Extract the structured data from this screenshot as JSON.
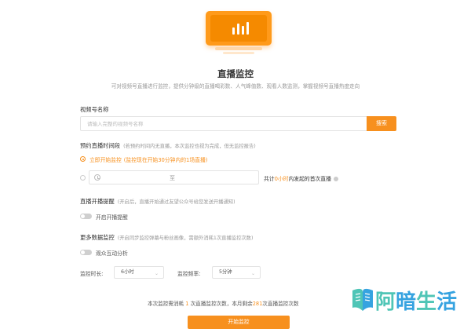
{
  "header": {
    "title": "直播监控",
    "subtitle": "可对视频号直播进行监控，提供分钟级的直播喝彩数、人气峰值数、观看人数监测，掌握视频号直播热度走向"
  },
  "channel": {
    "label": "视频号名称",
    "placeholder": "请输入完整的视频号名称",
    "value": "",
    "search_label": "搜索"
  },
  "schedule": {
    "label": "预约直播时间段",
    "note": "(若预约时间内无直播，本次监控也视为完成，但无监控报告)",
    "option_now": "立即开始监控",
    "option_now_note": "(监控现在开始30分钟内的1场直播)",
    "option_now_selected": true,
    "range_separator": "至",
    "range_summary_prefix": "共计",
    "range_summary_hours": "0小时",
    "range_summary_suffix": "内发起的首次直播"
  },
  "remind": {
    "label": "直播开播提醒",
    "note": "(开启后，直播开始通过友望公众号给您发送开播通知)",
    "toggle_label": "开启开播提醒",
    "enabled": false
  },
  "more": {
    "label": "更多数据监控",
    "note": "(开启同步监控弹幕与粉丝画像，需额外消耗1次直播监控次数)",
    "toggle_label": "观众互动分析",
    "enabled": false
  },
  "settings": {
    "duration_label": "监控时长:",
    "duration_value": "6小时",
    "frequency_label": "监控频率:",
    "frequency_value": "5分钟"
  },
  "quota": {
    "prefix": "本次监控需消耗",
    "cost": "1",
    "middle": "次直播监控次数，本月剩余",
    "remaining": "281",
    "suffix": "次直播监控次数"
  },
  "submit_label": "开始监控",
  "watermark": {
    "chars": [
      "阿",
      "暗",
      "生",
      "活"
    ]
  },
  "colors": {
    "accent": "#f7901e",
    "watermark_green": "#4fc5b6",
    "watermark_blue": "#36a3e0"
  }
}
